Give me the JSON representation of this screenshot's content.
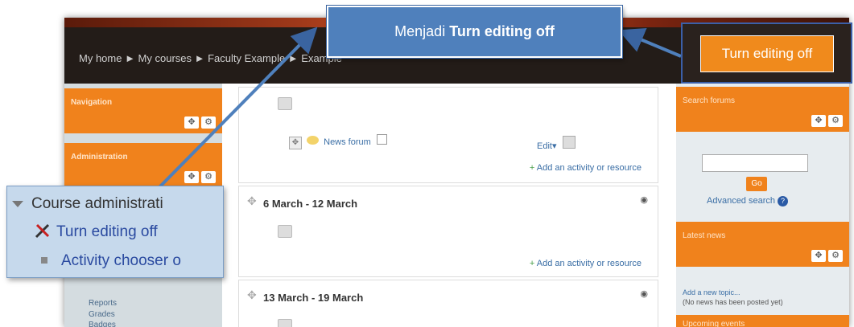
{
  "callout": {
    "text_prefix": "Menjadi ",
    "text_bold": "Turn editing off"
  },
  "header": {
    "breadcrumb": "My home ► My courses ► Faculty Example ► Example",
    "button_label": "Turn editing off"
  },
  "left": {
    "navigation_title": "Navigation",
    "administration_title": "Administration",
    "nav_items": [
      "Reports",
      "Grades",
      "Badges"
    ]
  },
  "zoom": {
    "heading": "Course administrati",
    "item1": "Turn editing off",
    "item2": "Activity chooser o"
  },
  "main": {
    "news_forum": "News forum",
    "edit_label": "Edit",
    "add_activity": "Add an activity or resource",
    "section1_title": "6 March - 12 March",
    "section2_title": "13 March - 19 March"
  },
  "right": {
    "search_title": "Search forums",
    "go_label": "Go",
    "advanced_search": "Advanced search",
    "latest_news_title": "Latest news",
    "add_topic": "Add a new topic...",
    "no_news": "(No news has been posted yet)",
    "upcoming_title": "Upcoming events"
  },
  "colors": {
    "accent": "#f0821c",
    "callout": "#4f80bc",
    "header": "#231c18"
  }
}
